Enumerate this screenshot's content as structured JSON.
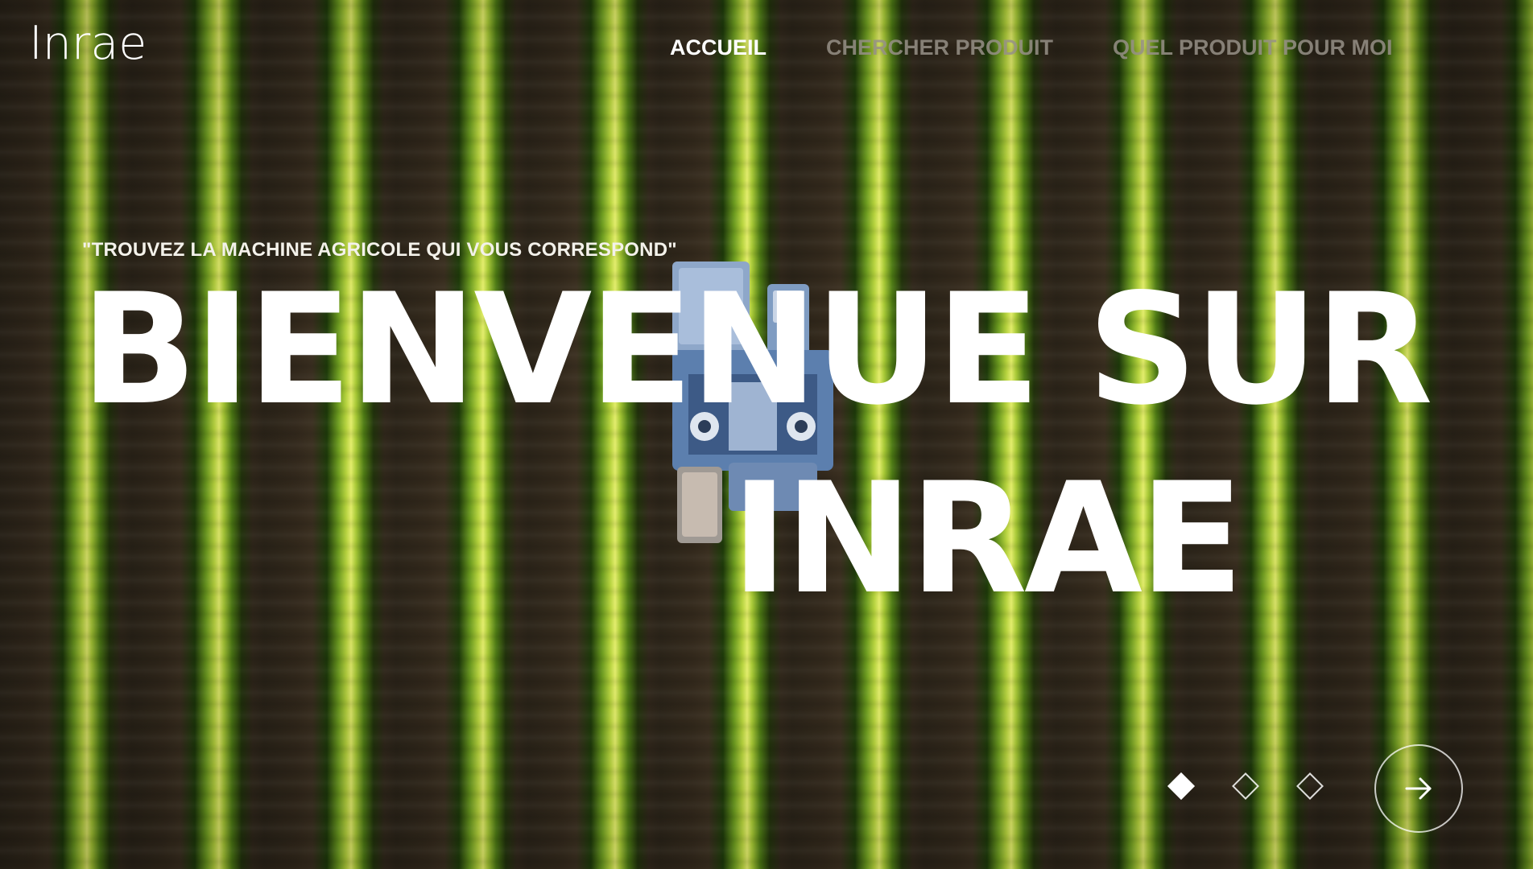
{
  "brand": {
    "logo_text": "Inrae"
  },
  "nav": {
    "items": [
      {
        "label": "ACCUEIL",
        "active": true
      },
      {
        "label": "CHERCHER  PRODUIT",
        "active": false
      },
      {
        "label": "QUEL PRODUIT POUR MOI",
        "active": false
      }
    ]
  },
  "hero": {
    "tagline": "\"TROUVEZ LA MACHINE AGRICOLE QUI VOUS CORRESPOND\"",
    "headline_line1": "BIENVENUE SUR",
    "headline_line2": "INRAE"
  },
  "slider": {
    "current_slide": 1,
    "total_slides": 3,
    "next_icon": "arrow-right-icon"
  },
  "colors": {
    "text": "#ffffff",
    "nav_inactive": "#969187"
  }
}
